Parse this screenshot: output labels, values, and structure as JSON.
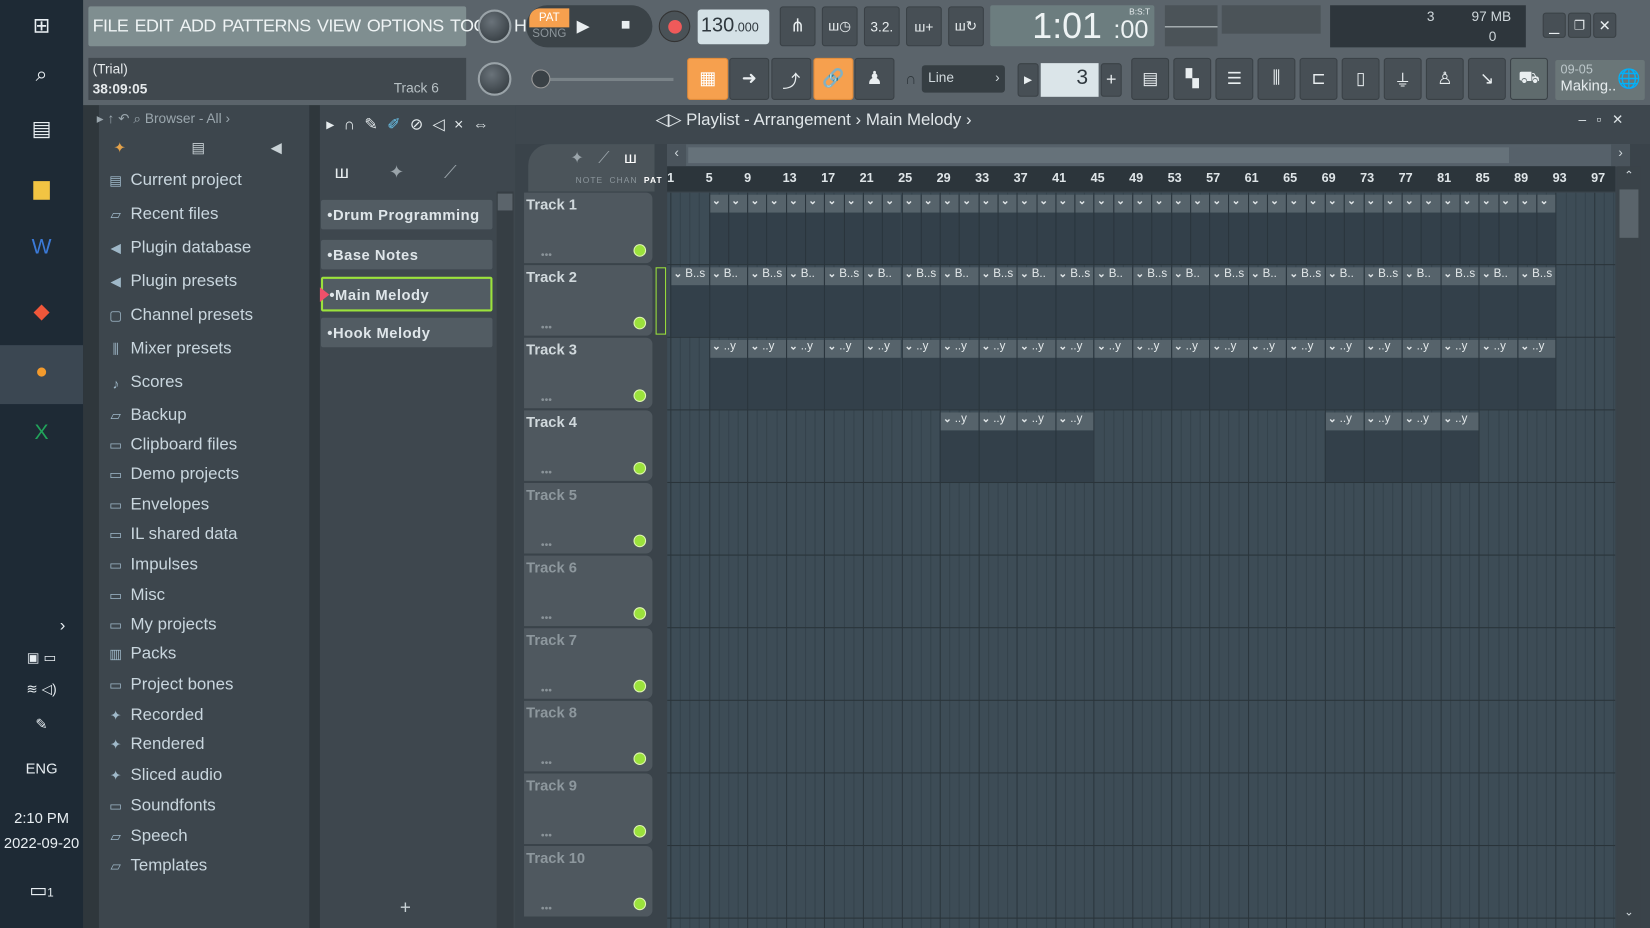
{
  "taskbar": {
    "lang": "ENG",
    "time": "2:10 PM",
    "date": "2022-09-20",
    "notifications": "1",
    "icons": [
      "windows-icon",
      "search-icon",
      "task-view-icon",
      "file-explorer-icon",
      "word-icon",
      "brave-icon",
      "fl-studio-icon",
      "excel-icon"
    ]
  },
  "menu": [
    "FILE",
    "EDIT",
    "ADD",
    "PATTERNS",
    "VIEW",
    "OPTIONS",
    "TOOLS",
    "HELP"
  ],
  "info": {
    "line1": "(Trial)",
    "line2": "38:09:05",
    "hint": "Track 6"
  },
  "transport": {
    "pat": "PAT",
    "song": "SONG",
    "tempo": "130",
    "tempo_dec": ".000",
    "time": "1:01",
    "time_sub": ":00",
    "time_format": "B:S:T",
    "cpu": "3",
    "memory": "97 MB",
    "poly": "0"
  },
  "toolbar2": {
    "snap": "Line",
    "pattern_num": "3",
    "news_date": "09-05",
    "news_text": "Making.."
  },
  "colors": {
    "accent_orange": "#f6a04e",
    "active_green": "#9be23c",
    "record": "#f05a5a"
  },
  "browser": {
    "title": "Browser - All",
    "items": [
      {
        "label": "Current project",
        "icon": "project-icon"
      },
      {
        "label": "Recent files",
        "icon": "folder-recent-icon"
      },
      {
        "label": "Plugin database",
        "icon": "plugin-icon"
      },
      {
        "label": "Plugin presets",
        "icon": "plugin-icon"
      },
      {
        "label": "Channel presets",
        "icon": "channel-icon"
      },
      {
        "label": "Mixer presets",
        "icon": "mixer-icon"
      },
      {
        "label": "Scores",
        "icon": "note-icon"
      },
      {
        "label": "Backup",
        "icon": "folder-recent-icon"
      },
      {
        "label": "Clipboard files",
        "icon": "folder-icon"
      },
      {
        "label": "Demo projects",
        "icon": "folder-icon"
      },
      {
        "label": "Envelopes",
        "icon": "folder-icon"
      },
      {
        "label": "IL shared data",
        "icon": "folder-icon"
      },
      {
        "label": "Impulses",
        "icon": "folder-icon"
      },
      {
        "label": "Misc",
        "icon": "folder-icon"
      },
      {
        "label": "My projects",
        "icon": "folder-icon"
      },
      {
        "label": "Packs",
        "icon": "packs-icon"
      },
      {
        "label": "Project bones",
        "icon": "folder-icon"
      },
      {
        "label": "Recorded",
        "icon": "audio-icon"
      },
      {
        "label": "Rendered",
        "icon": "audio-icon"
      },
      {
        "label": "Sliced audio",
        "icon": "audio-icon"
      },
      {
        "label": "Soundfonts",
        "icon": "folder-icon"
      },
      {
        "label": "Speech",
        "icon": "folder-recent-icon"
      },
      {
        "label": "Templates",
        "icon": "folder-recent-icon"
      }
    ]
  },
  "patterns": {
    "items": [
      "Drum Programming",
      "Base Notes",
      "Main Melody",
      "Hook Melody"
    ],
    "selected": "Main Melody",
    "add": "+"
  },
  "playlist": {
    "title": "Playlist - Arrangement",
    "pattern": "Main Melody",
    "tabs": [
      "NOTE",
      "CHAN",
      "PAT"
    ],
    "ruler": [
      1,
      5,
      9,
      13,
      17,
      21,
      25,
      29,
      33,
      37,
      41,
      45,
      49,
      53,
      57,
      61,
      65,
      69,
      73,
      77,
      81,
      85,
      89,
      93,
      97
    ],
    "tracks": [
      {
        "name": "Track 1",
        "clips": {
          "start": 5,
          "end": 93,
          "length": 2,
          "labels": [
            ""
          ]
        }
      },
      {
        "name": "Track 2",
        "clips": {
          "start": 1,
          "end": 93,
          "length": 4,
          "labels": [
            "B..s",
            "B.."
          ]
        }
      },
      {
        "name": "Track 3",
        "clips": {
          "start": 5,
          "end": 93,
          "length": 4,
          "labels": [
            "..y"
          ]
        }
      },
      {
        "name": "Track 4",
        "clips": [
          {
            "start": 29,
            "end": 45,
            "length": 4,
            "labels": [
              "..y"
            ]
          },
          {
            "start": 69,
            "end": 85,
            "length": 4,
            "labels": [
              "..y"
            ]
          }
        ]
      },
      {
        "name": "Track 5"
      },
      {
        "name": "Track 6"
      },
      {
        "name": "Track 7"
      },
      {
        "name": "Track 8"
      },
      {
        "name": "Track 9"
      },
      {
        "name": "Track 10"
      }
    ]
  }
}
